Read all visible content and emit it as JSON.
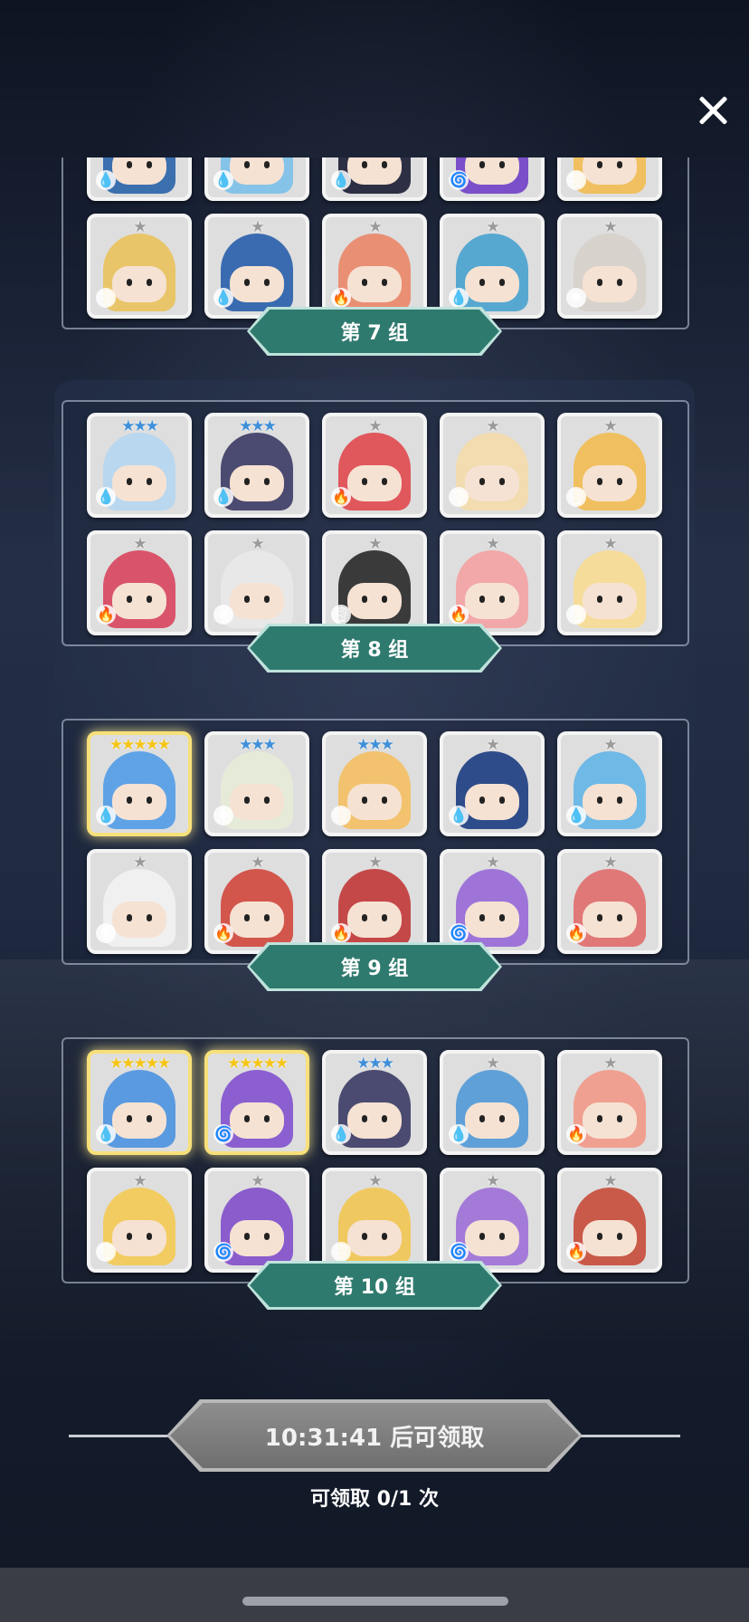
{
  "close_icon": "close-icon",
  "groups": [
    {
      "label": "第 7 组",
      "cards": [
        {
          "stars": "",
          "element": "water",
          "color": "#3b6fae"
        },
        {
          "stars": "",
          "element": "water",
          "color": "#86c3e8"
        },
        {
          "stars": "",
          "element": "water",
          "color": "#2d2f44"
        },
        {
          "stars": "",
          "element": "arcane",
          "color": "#7a4fc9"
        },
        {
          "stars": "",
          "element": "earth",
          "color": "#f0c060"
        },
        {
          "stars": "★",
          "element": "earth",
          "color": "#e9c56a"
        },
        {
          "stars": "★",
          "element": "water",
          "color": "#3a6bb0"
        },
        {
          "stars": "★",
          "element": "fire",
          "color": "#e98f74"
        },
        {
          "stars": "★",
          "element": "water",
          "color": "#56a8d0"
        },
        {
          "stars": "★",
          "element": "light",
          "color": "#d8d2cc"
        }
      ]
    },
    {
      "label": "第 8 组",
      "cards": [
        {
          "stars": "★★★",
          "element": "water",
          "color": "#b9d7ef"
        },
        {
          "stars": "★★★",
          "element": "water",
          "color": "#4b4a70"
        },
        {
          "stars": "★",
          "element": "fire",
          "color": "#e0575c"
        },
        {
          "stars": "★",
          "element": "earth",
          "color": "#f2dcb0"
        },
        {
          "stars": "★",
          "element": "earth",
          "color": "#f0c060"
        },
        {
          "stars": "★",
          "element": "fire",
          "color": "#d9546a"
        },
        {
          "stars": "★",
          "element": "light",
          "color": "#e8e8e8"
        },
        {
          "stars": "★",
          "element": "earth",
          "color": "#3a3a3a"
        },
        {
          "stars": "★",
          "element": "fire",
          "color": "#f2a8a8"
        },
        {
          "stars": "★",
          "element": "earth",
          "color": "#f6dc9a"
        }
      ]
    },
    {
      "label": "第 9 组",
      "cards": [
        {
          "stars": "★★★★★",
          "element": "water",
          "color": "#5fa3e6",
          "rarity": "gold"
        },
        {
          "stars": "★★★",
          "element": "light",
          "color": "#e6ead8"
        },
        {
          "stars": "★★★",
          "element": "earth",
          "color": "#f2c26e"
        },
        {
          "stars": "★",
          "element": "water",
          "color": "#2e4c8a"
        },
        {
          "stars": "★",
          "element": "water",
          "color": "#6fb9e6"
        },
        {
          "stars": "★",
          "element": "light",
          "color": "#f0f0f0"
        },
        {
          "stars": "★",
          "element": "fire",
          "color": "#d2564c"
        },
        {
          "stars": "★",
          "element": "fire",
          "color": "#c44848"
        },
        {
          "stars": "★",
          "element": "arcane",
          "color": "#9e74d9"
        },
        {
          "stars": "★",
          "element": "fire",
          "color": "#e17878"
        }
      ]
    },
    {
      "label": "第 10 组",
      "cards": [
        {
          "stars": "★★★★★",
          "element": "water",
          "color": "#5a9ae0",
          "rarity": "gold"
        },
        {
          "stars": "★★★★★",
          "element": "arcane",
          "color": "#8b5fd0",
          "rarity": "gold"
        },
        {
          "stars": "★★★",
          "element": "water",
          "color": "#4b4a70"
        },
        {
          "stars": "★",
          "element": "water",
          "color": "#5fa0d8"
        },
        {
          "stars": "★",
          "element": "fire",
          "color": "#f0a090"
        },
        {
          "stars": "★",
          "element": "earth",
          "color": "#f2cc60"
        },
        {
          "stars": "★",
          "element": "arcane",
          "color": "#8a5ccc"
        },
        {
          "stars": "★",
          "element": "earth",
          "color": "#f0c860"
        },
        {
          "stars": "★",
          "element": "arcane",
          "color": "#a47ad8"
        },
        {
          "stars": "★",
          "element": "fire",
          "color": "#c95a4a"
        }
      ]
    }
  ],
  "element_glyphs": {
    "water": "💧",
    "fire": "🔥",
    "earth": "🌪",
    "arcane": "🌀",
    "light": "✹"
  },
  "claim": {
    "button_label": "10:31:41 后可领取",
    "count_text": "可领取 0/1 次"
  }
}
